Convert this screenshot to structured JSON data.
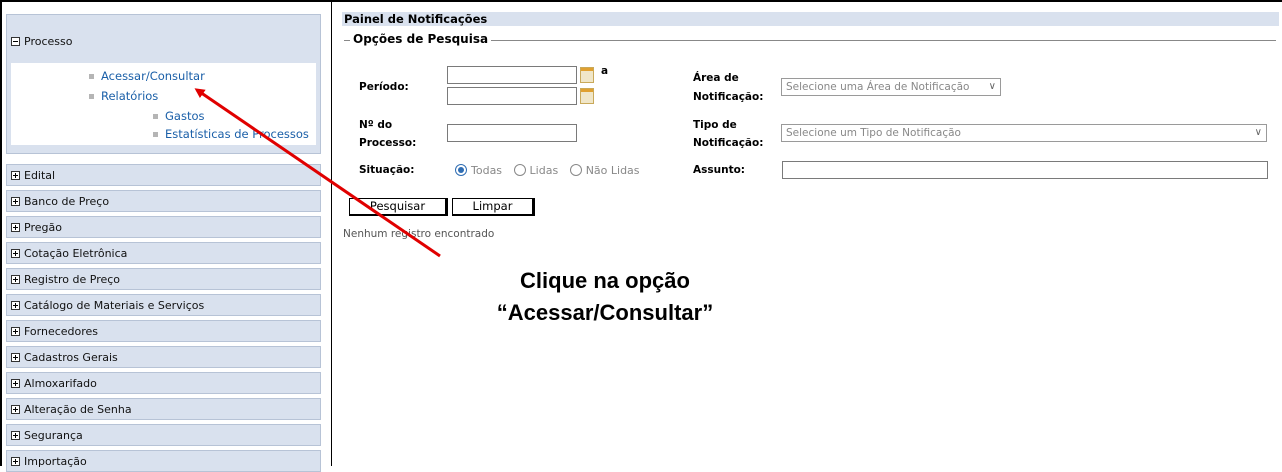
{
  "sidebar": {
    "open_section": {
      "label": "Processo",
      "items": [
        {
          "label": "Acessar/Consultar"
        },
        {
          "label": "Relatórios"
        }
      ],
      "subitems": [
        {
          "label": "Gastos"
        },
        {
          "label": "Estatísticas de Processos"
        }
      ]
    },
    "sections": [
      {
        "label": "Edital"
      },
      {
        "label": "Banco de Preço"
      },
      {
        "label": "Pregão"
      },
      {
        "label": "Cotação Eletrônica"
      },
      {
        "label": "Registro de Preço"
      },
      {
        "label": "Catálogo de Materiais e Serviços"
      },
      {
        "label": "Fornecedores"
      },
      {
        "label": "Cadastros Gerais"
      },
      {
        "label": "Almoxarifado"
      },
      {
        "label": "Alteração de Senha"
      },
      {
        "label": "Segurança"
      },
      {
        "label": "Importação"
      }
    ]
  },
  "panel": {
    "title": "Painel de Notificações",
    "legend": "Opções de Pesquisa",
    "periodo_label": "Período:",
    "periodo_sep": "a",
    "area_label_1": "Área de",
    "area_label_2": "Notificação:",
    "area_select": "Selecione uma Área de Notificação",
    "processo_label_1": "Nº do",
    "processo_label_2": "Processo:",
    "tipo_label_1": "Tipo de",
    "tipo_label_2": "Notificação:",
    "tipo_select": "Selecione um Tipo de Notificação",
    "situacao_label": "Situação:",
    "situacao_options": [
      "Todas",
      "Lidas",
      "Não Lidas"
    ],
    "situacao_selected": "Todas",
    "assunto_label": "Assunto:",
    "search_button": "Pesquisar",
    "clear_button": "Limpar",
    "no_results": "Nenhum registro encontrado"
  },
  "annotation": {
    "line1": "Clique na opção",
    "line2": "“Acessar/Consultar”",
    "arrow_color": "#e00000"
  }
}
